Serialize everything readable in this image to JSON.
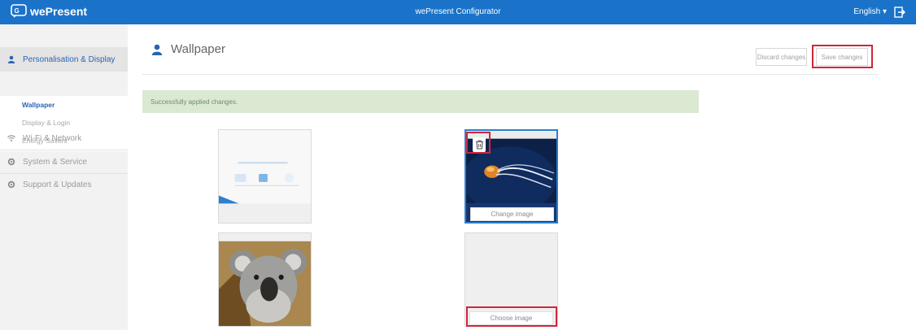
{
  "topbar": {
    "brand": "wePresent",
    "title": "wePresent Configurator",
    "language": "English ▾"
  },
  "sidebar": {
    "sections": [
      {
        "label": "Personalisation & Display",
        "icon": "user-icon",
        "active": true
      },
      {
        "label": "Wi-Fi & Network",
        "icon": "wifi-icon"
      },
      {
        "label": "System & Service",
        "icon": "gear-icon"
      },
      {
        "label": "Support & Updates",
        "icon": "gear-icon"
      }
    ],
    "subitems": [
      {
        "label": "Wallpaper",
        "active": true
      },
      {
        "label": "Display & Login"
      },
      {
        "label": "Energy Savers"
      }
    ]
  },
  "page": {
    "title": "Wallpaper",
    "icon": "user-icon"
  },
  "actions": {
    "discard_label": "Discard changes",
    "save_label": "Save changes"
  },
  "alert": {
    "message": "Successfully applied changes."
  },
  "tiles": {
    "change_label": "Change image",
    "choose_label": "Choose image"
  },
  "colors": {
    "topbar": "#1a73c9",
    "accent": "#2a64b2",
    "highlight": "#d0263a",
    "success_bg": "#dbe9d3"
  }
}
